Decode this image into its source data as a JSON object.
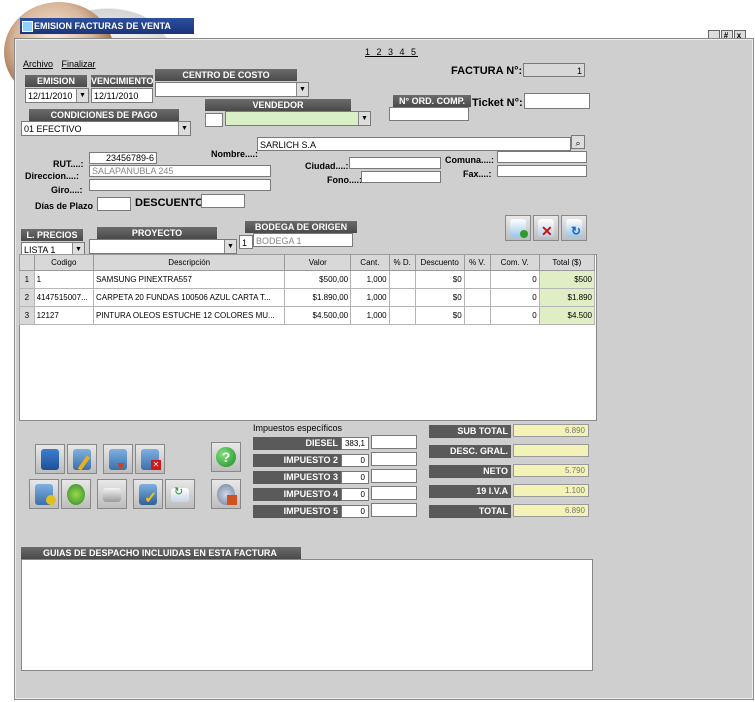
{
  "window": {
    "title": "EMISION FACTURAS DE VENTA",
    "controls": [
      "_",
      "#",
      "x"
    ],
    "menu": [
      "Archivo",
      "Finalizar"
    ],
    "pager": "1 2 3 4 5"
  },
  "header": {
    "factura_label": "FACTURA N°:",
    "factura_value": "1",
    "emision_label": "EMISION",
    "emision_value": "12/11/2010",
    "vencimiento_label": "VENCIMIENTO",
    "vencimiento_value": "12/11/2010",
    "centro_costo_label": "CENTRO DE COSTO",
    "centro_costo_value": "",
    "condiciones_label": "CONDICIONES DE PAGO",
    "condiciones_value": "01 EFECTIVO",
    "vendedor_label": "VENDEDOR",
    "vendedor_value": "",
    "orden_label": "N° ORD. COMP.",
    "orden_value": "",
    "ticket_label": "Ticket N°:",
    "ticket_value": ""
  },
  "client": {
    "nombre_label": "Nombre....:",
    "nombre_value": "SARLICH S.A",
    "rut_label": "RUT....:",
    "rut_value": "23456789-6",
    "direccion_label": "Direccion....:",
    "direccion_value": "SALAPANUBLA 245",
    "giro_label": "Giro....:",
    "giro_value": "",
    "ciudad_label": "Ciudad....:",
    "ciudad_value": "",
    "fono_label": "Fono....:",
    "fono_value": "",
    "comuna_label": "Comuna....:",
    "comuna_value": "",
    "fax_label": "Fax....:",
    "fax_value": "",
    "dias_label": "Días de Plazo",
    "dias_value": "",
    "descuento_label": "DESCUENTO",
    "descuento_value": ""
  },
  "selectors": {
    "precios_label": "L. PRECIOS",
    "precios_value": "LISTA 1",
    "proyecto_label": "PROYECTO",
    "proyecto_value": "",
    "bodega_label": "BODEGA DE ORIGEN",
    "bodega_num": "1",
    "bodega_value": "BODEGA 1"
  },
  "grid": {
    "columns": [
      "Codigo",
      "Descripción",
      "Valor",
      "Cant.",
      "% D.",
      "Descuento",
      "% V.",
      "Com. V.",
      "Total ($)"
    ],
    "rows": [
      {
        "n": "1",
        "codigo": "1",
        "descripcion": "SAMSUNG PINEXTRA557",
        "valor": "$500,00",
        "cant": "1,000",
        "pd": "",
        "descuento": "$0",
        "pv": "",
        "comv": "0",
        "total": "$500"
      },
      {
        "n": "2",
        "codigo": "4147515007...",
        "descripcion": "CARPETA 20 FUNDAS 100506 AZUL CARTA T...",
        "valor": "$1.890,00",
        "cant": "1,000",
        "pd": "",
        "descuento": "$0",
        "pv": "",
        "comv": "0",
        "total": "$1.890"
      },
      {
        "n": "3",
        "codigo": "12127",
        "descripcion": "PINTURA OLEOS ESTUCHE 12 COLORES MU...",
        "valor": "$4.500,00",
        "cant": "1,000",
        "pd": "",
        "descuento": "$0",
        "pv": "",
        "comv": "0",
        "total": "$4.500"
      }
    ]
  },
  "taxes": {
    "title": "Impuestos específicos",
    "items": [
      {
        "label": "DIESEL",
        "value": "383,1"
      },
      {
        "label": "IMPUESTO 2",
        "value": "0"
      },
      {
        "label": "IMPUESTO 3",
        "value": "0"
      },
      {
        "label": "IMPUESTO 4",
        "value": "0"
      },
      {
        "label": "IMPUESTO 5",
        "value": "0"
      }
    ]
  },
  "totals": [
    {
      "label": "SUB TOTAL",
      "value": "6.890"
    },
    {
      "label": "DESC. GRAL.",
      "value": ""
    },
    {
      "label": "NETO",
      "value": "5.790"
    },
    {
      "label": "19  I.V.A",
      "value": "1.100"
    },
    {
      "label": "TOTAL",
      "value": "6.890"
    }
  ],
  "guias_label": "GUIAS DE DESPACHO INCLUIDAS EN ESTA FACTURA",
  "colors": {
    "window_bg": "#cfcfcf",
    "label_dark": "#5a5a5a",
    "title_blue": "#1a3478",
    "total_yellow": "#f3f3b8",
    "vendedor_green": "#d9efc6"
  },
  "icons": [
    "save-icon",
    "edit-icon",
    "down-icon",
    "delete-icon",
    "help-icon",
    "db-export-icon",
    "recycle-icon",
    "print-icon",
    "check-icon",
    "mail-icon",
    "settings-icon",
    "add-row-icon",
    "remove-row-icon",
    "refresh-icon",
    "search-icon"
  ]
}
